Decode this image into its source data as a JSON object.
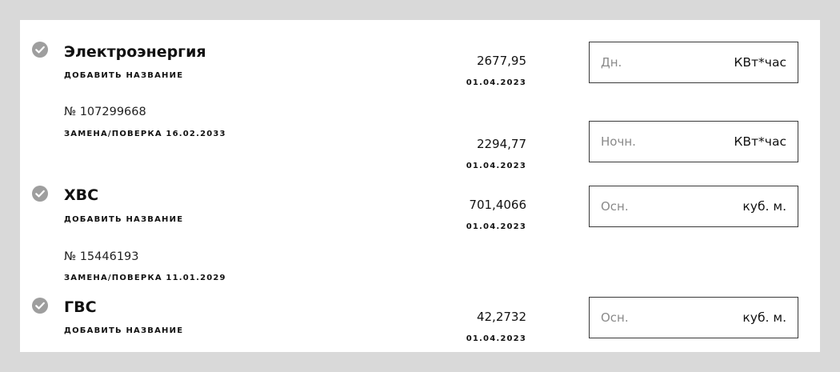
{
  "colors": {
    "page_background": "#d9d9d9",
    "card_background": "#ffffff",
    "check_icon": "#9e9e9e",
    "input_border": "#3a3a3a",
    "placeholder": "#8a8a8a"
  },
  "meters": [
    {
      "title": "Электроэнергия",
      "add_name": "ДОБАВИТЬ НАЗВАНИЕ",
      "serial": "№ 107299668",
      "replace": "ЗАМЕНА/ПОВЕРКА 16.02.2033",
      "icon": "check-circle-icon",
      "tariffs": [
        {
          "reading": "2677,95",
          "date": "01.04.2023",
          "placeholder": "Дн.",
          "unit": "КВт*час"
        },
        {
          "reading": "2294,77",
          "date": "01.04.2023",
          "placeholder": "Ночн.",
          "unit": "КВт*час"
        }
      ]
    },
    {
      "title": "ХВС",
      "add_name": "ДОБАВИТЬ НАЗВАНИЕ",
      "serial": "№ 15446193",
      "replace": "ЗАМЕНА/ПОВЕРКА 11.01.2029",
      "icon": "check-circle-icon",
      "tariffs": [
        {
          "reading": "701,4066",
          "date": "01.04.2023",
          "placeholder": "Осн.",
          "unit": "куб. м."
        }
      ]
    },
    {
      "title": "ГВС",
      "add_name": "ДОБАВИТЬ НАЗВАНИЕ",
      "icon": "check-circle-icon",
      "tariffs": [
        {
          "reading": "42,2732",
          "date": "01.04.2023",
          "placeholder": "Осн.",
          "unit": "куб. м."
        }
      ]
    }
  ]
}
